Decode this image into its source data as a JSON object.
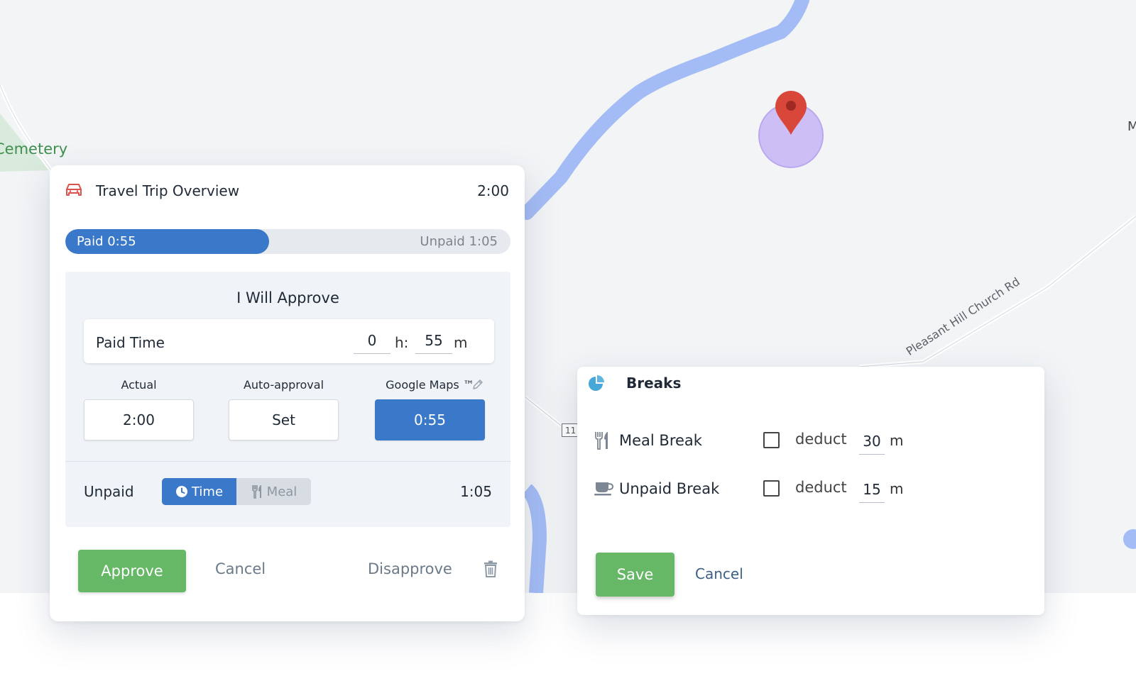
{
  "map": {
    "place_label": "Cemetery",
    "road_label": "Pleasant Hill Church Rd",
    "route_shield": "11",
    "edge_label": "M"
  },
  "trip": {
    "title": "Travel Trip Overview",
    "total": "2:00",
    "progress": {
      "paid_label": "Paid 0:55",
      "unpaid_label": "Unpaid 1:05",
      "paid_fraction": 0.458
    },
    "panel_title": "I Will Approve",
    "paid_time": {
      "label": "Paid Time",
      "hours": "0",
      "hours_unit": "h:",
      "minutes": "55",
      "minutes_unit": "m"
    },
    "options": [
      {
        "label": "Actual",
        "value": "2:00"
      },
      {
        "label": "Auto-approval",
        "value": "Set"
      },
      {
        "label": "Google Maps ™",
        "value": "0:55"
      }
    ],
    "unpaid": {
      "label": "Unpaid",
      "toggle_time": "Time",
      "toggle_meal": "Meal",
      "value": "1:05"
    },
    "actions": {
      "approve": "Approve",
      "cancel": "Cancel",
      "disapprove": "Disapprove"
    }
  },
  "breaks": {
    "title": "Breaks",
    "items": [
      {
        "label": "Meal Break",
        "deduct_label": "deduct",
        "minutes": "30",
        "unit": "m"
      },
      {
        "label": "Unpaid Break",
        "deduct_label": "deduct",
        "minutes": "15",
        "unit": "m"
      }
    ],
    "actions": {
      "save": "Save",
      "cancel": "Cancel"
    }
  },
  "colors": {
    "primary": "#3a78c9",
    "success": "#66b866",
    "car_icon": "#d9534f",
    "marker": "#d9463a",
    "marker_halo": "#cdbff5",
    "river": "#a4bcf5",
    "pie_icon": "#45a8d8"
  }
}
